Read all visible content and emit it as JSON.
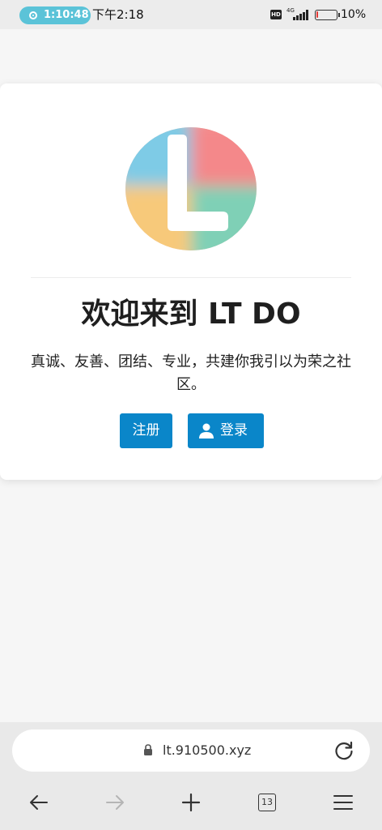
{
  "status_bar": {
    "recording_time": "1:10:48",
    "clock": "下午2:18",
    "hd_badge": "HD",
    "network_type": "4G",
    "battery_percent": "10%",
    "battery_level": 0.1,
    "battery_color": "#e53935",
    "recording_color": "#5bc3d8"
  },
  "page": {
    "logo_icon": "lt-do-logo",
    "title": "欢迎来到 LT DO",
    "subtitle": "真诚、友善、团结、专业，共建你我引以为荣之社区。",
    "register_label": "注册",
    "login_label": "登录",
    "login_icon": "user-icon",
    "accent_color": "#0a86c9"
  },
  "browser": {
    "url": "lt.910500.xyz",
    "lock_icon": "lock-icon",
    "reload_icon": "reload-icon",
    "tab_count": "13",
    "nav_icons": [
      "back-arrow-icon",
      "forward-arrow-icon",
      "plus-icon",
      "tabs-icon",
      "menu-icon"
    ]
  }
}
